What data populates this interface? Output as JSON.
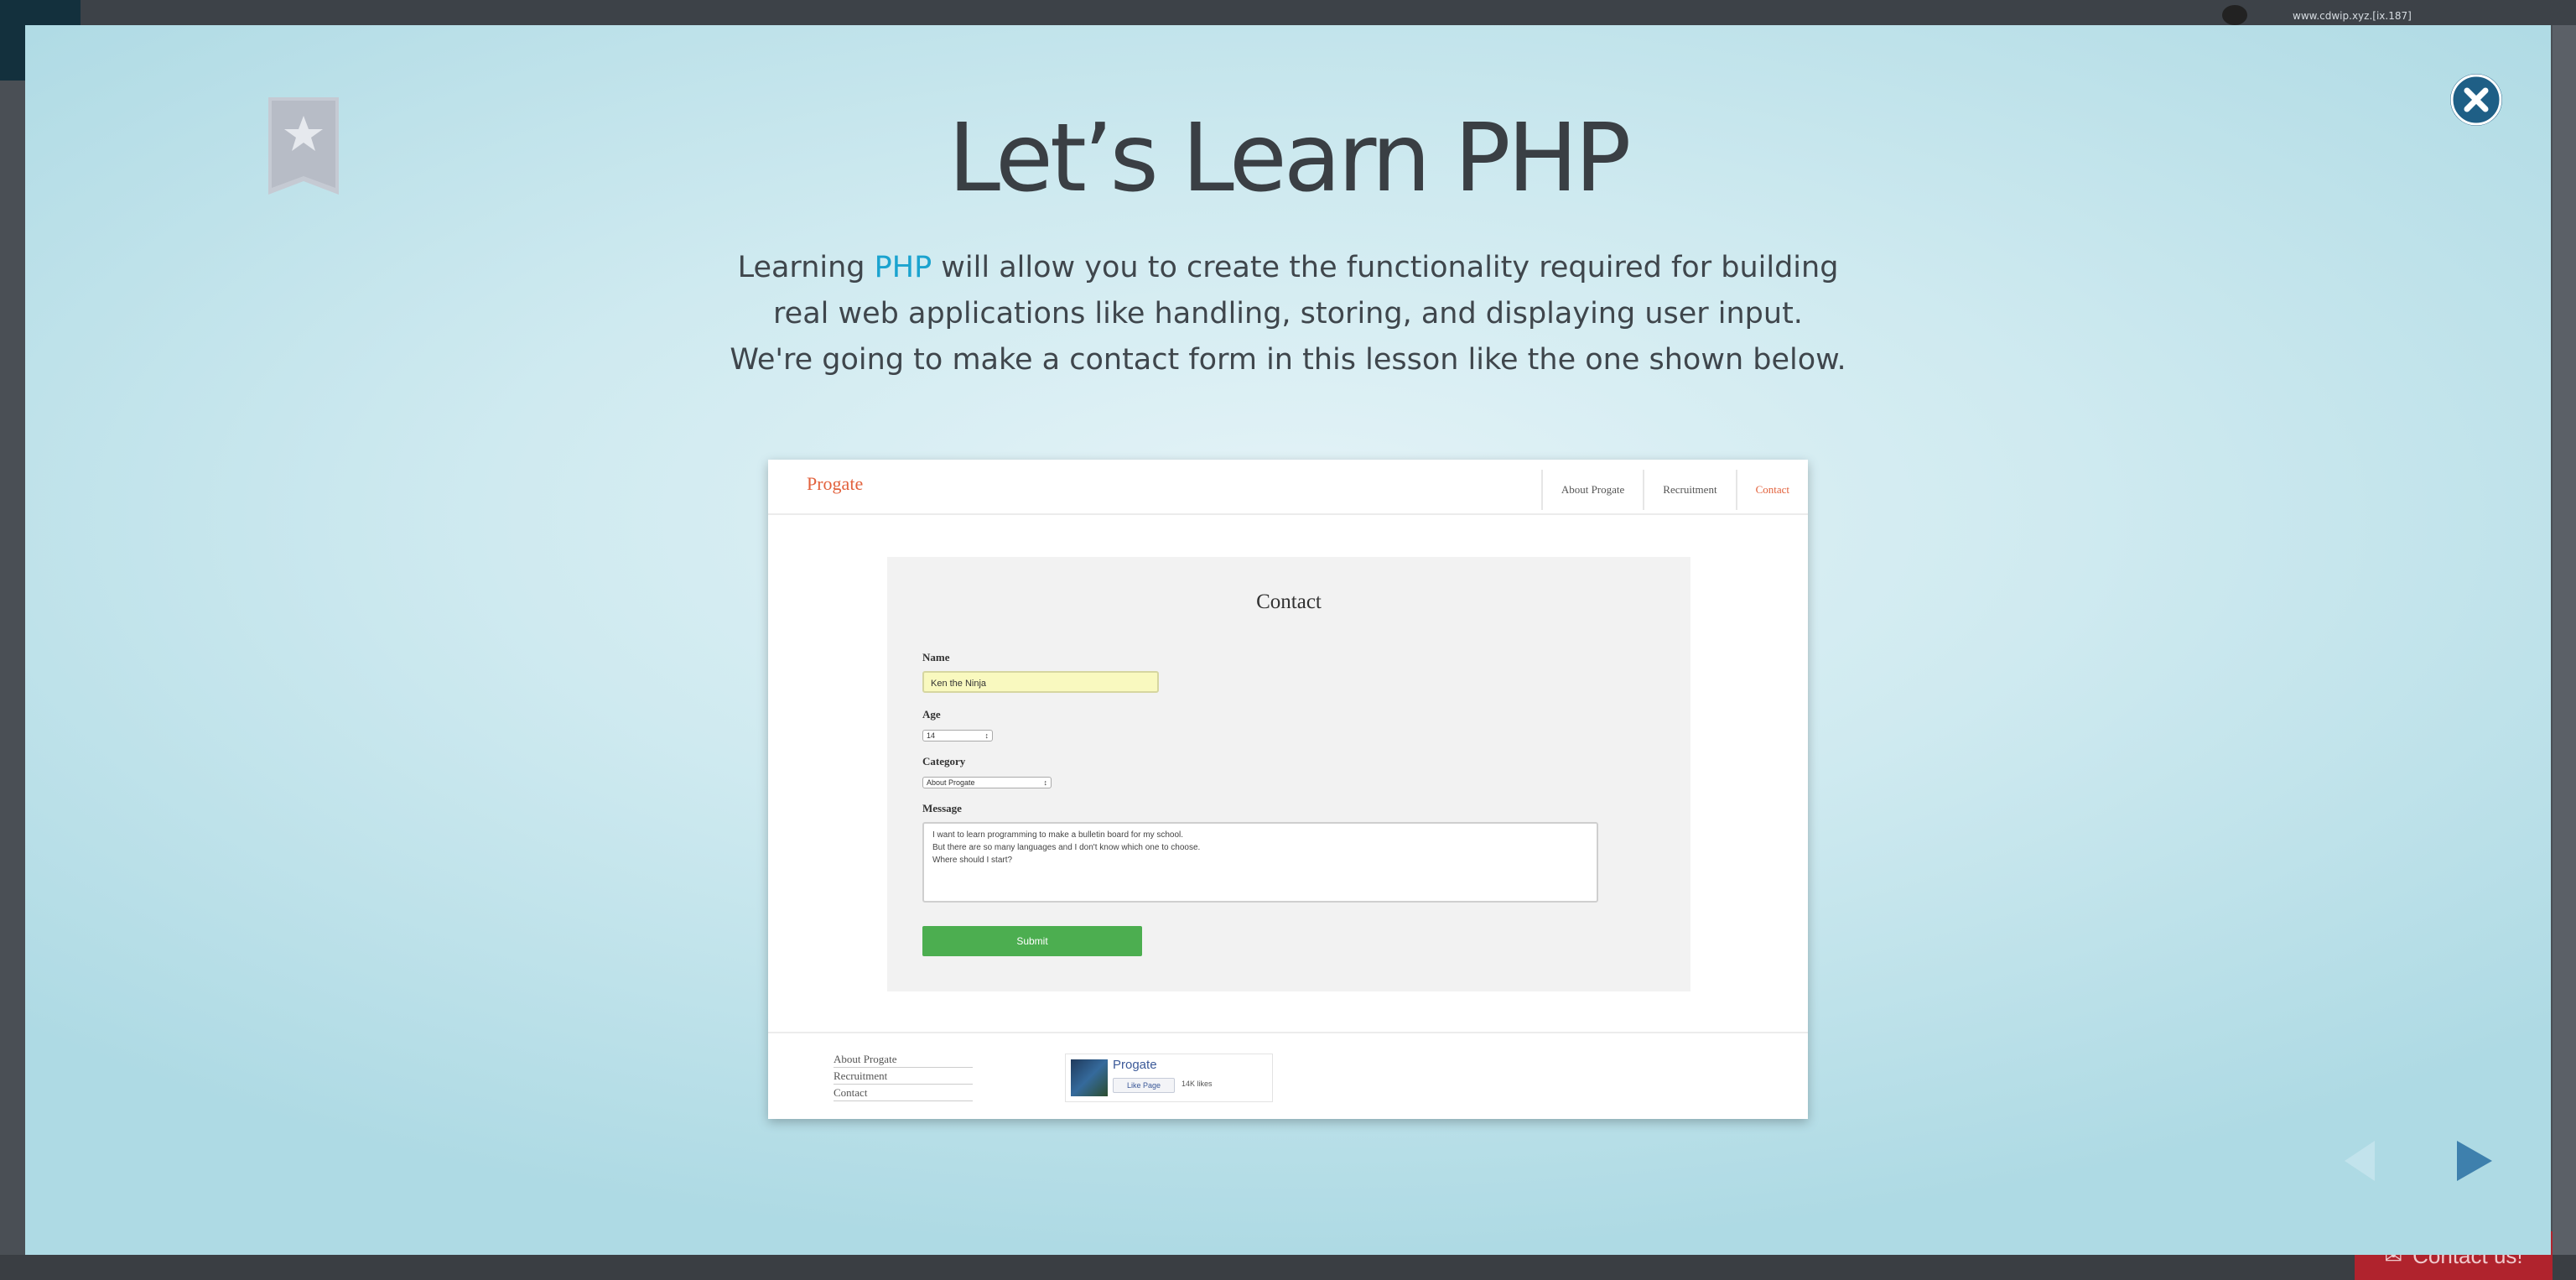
{
  "background": {
    "url_text": "www.cdwip.xyz.[ix.187]",
    "contact_label": "Contact us!"
  },
  "modal": {
    "title": "Let’s Learn PHP",
    "description": {
      "line1_before": "Learning ",
      "line1_link": "PHP",
      "line1_after": " will allow you to create the functionality required for building",
      "line2": "real web applications like handling, storing, and displaying user input.",
      "line3": "We're going to make a contact form in this lesson like the one shown below."
    },
    "accent_color": "#1ba3cf",
    "close_icon": "close-icon",
    "bookmark_icon": "bookmark-star-icon"
  },
  "screenshot": {
    "logo": "Progate",
    "nav": [
      "About Progate",
      "Recruitment",
      "Contact"
    ],
    "form": {
      "title": "Contact",
      "name_label": "Name",
      "name_value": "Ken the Ninja",
      "age_label": "Age",
      "age_value": "14",
      "category_label": "Category",
      "category_value": "About Progate",
      "message_label": "Message",
      "message_lines": [
        "I want to learn programming to make a bulletin board for my school.",
        "But there are so many languages and I don't know which one to choose.",
        "Where should I start?"
      ],
      "submit_label": "Submit"
    },
    "footer_links": [
      "About Progate",
      "Recruitment",
      "Contact"
    ],
    "fb": {
      "name": "Progate",
      "like_label": "Like Page",
      "count": "14K likes"
    }
  }
}
